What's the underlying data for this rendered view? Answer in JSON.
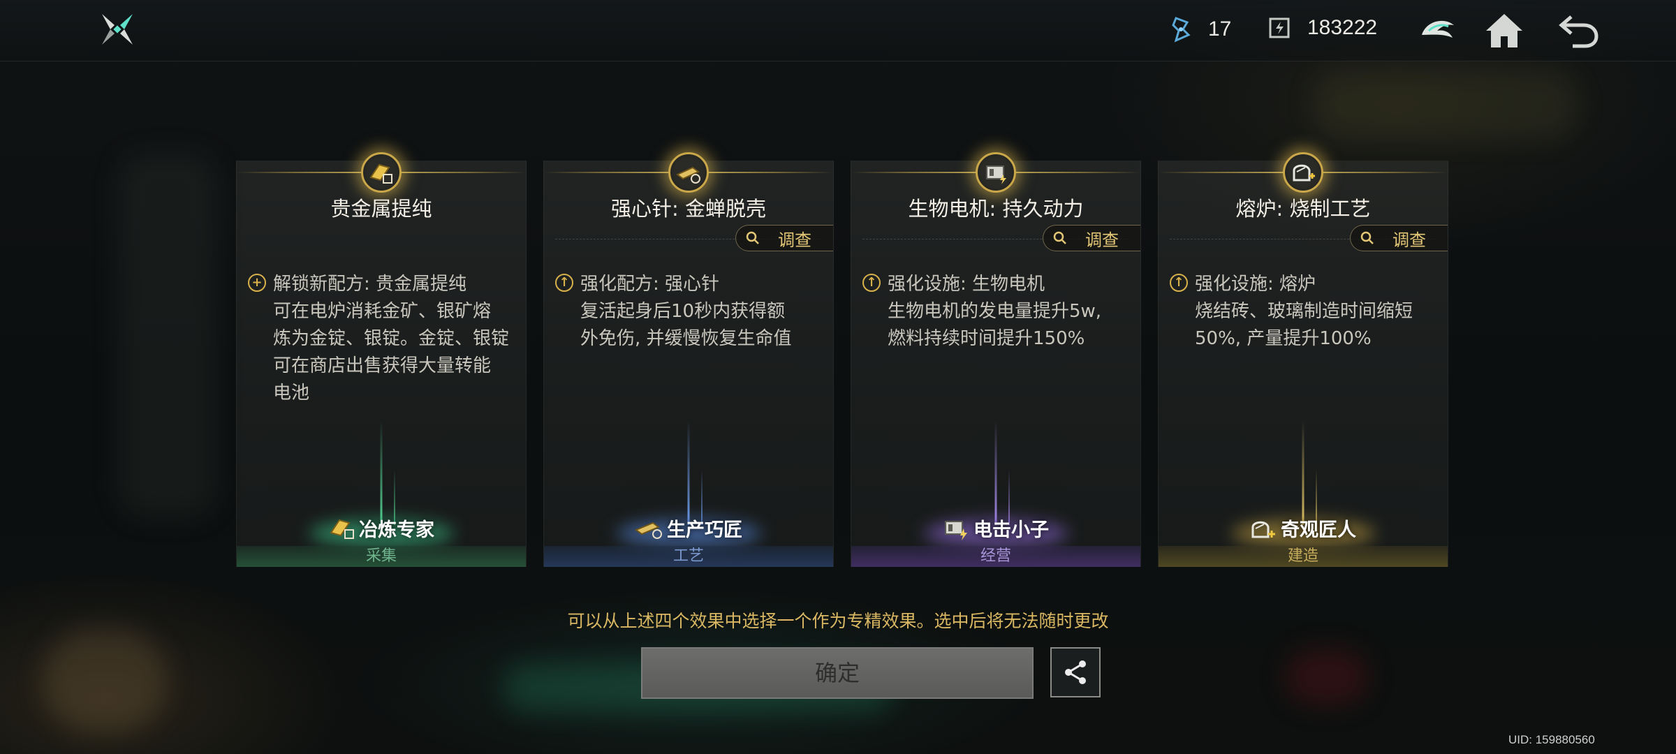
{
  "header": {
    "currencies": [
      {
        "icon": "energy-crystal-icon",
        "value": "17"
      },
      {
        "icon": "battery-chip-icon",
        "value": "183222"
      }
    ]
  },
  "cards": [
    {
      "badge_icon": "gold-ingot-icon",
      "title": "贵金属提纯",
      "has_investigate": false,
      "effect_icon": "plus-circle-icon",
      "effect_lines": [
        "解锁新配方: 贵金属提纯",
        "可在电炉消耗金矿、银矿熔",
        "炼为金锭、银锭。金锭、银锭",
        "可在商店出售获得大量转能",
        "电池"
      ],
      "role": "冶炼专家",
      "category": "采集"
    },
    {
      "badge_icon": "syringe-icon",
      "title": "强心针: 金蝉脱壳",
      "has_investigate": true,
      "effect_icon": "up-arrow-circle-icon",
      "effect_lines": [
        "强化配方: 强心针",
        "复活起身后10秒内获得额",
        "外免伤, 并缓慢恢复生命值"
      ],
      "role": "生产巧匠",
      "category": "工艺"
    },
    {
      "badge_icon": "generator-icon",
      "title": "生物电机: 持久动力",
      "has_investigate": true,
      "effect_icon": "up-arrow-circle-icon",
      "effect_lines": [
        "强化设施: 生物电机",
        "生物电机的发电量提升5w,",
        "燃料持续时间提升150%"
      ],
      "role": "电击小子",
      "category": "经营"
    },
    {
      "badge_icon": "furnace-icon",
      "title": "熔炉: 烧制工艺",
      "has_investigate": true,
      "effect_icon": "up-arrow-circle-icon",
      "effect_lines": [
        "强化设施: 熔炉",
        "烧结砖、玻璃制造时间缩短",
        "50%, 产量提升100%"
      ],
      "role": "奇观匠人",
      "category": "建造"
    }
  ],
  "investigate_label": "调查",
  "notice": "可以从上述四个效果中选择一个作为专精效果。选中后将无法随时更改",
  "confirm_label": "确定",
  "uid": "UID: 159880560",
  "colors": {
    "accent_gold": "#d9b763",
    "collect": "#6fb48c",
    "craft": "#7c9ad0",
    "manage": "#a895d8",
    "build": "#c8ae5c"
  }
}
